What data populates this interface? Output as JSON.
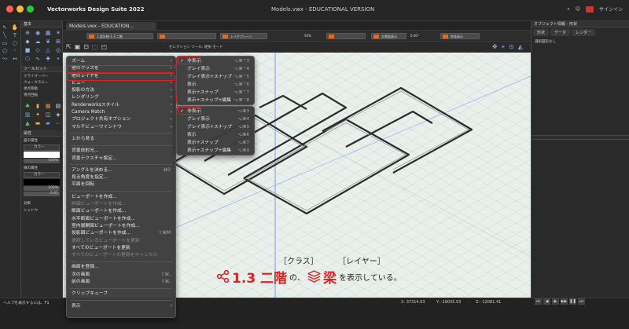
{
  "window": {
    "app_title": "Vectorworks Design Suite 2022",
    "document_title": "Models.vwx - EDUCATIONAL VERSION",
    "signin_label": "サインイン"
  },
  "colors": {
    "accent_red": "#e02020",
    "grid_bg": "#e9f0ec",
    "menu_bg": "#3c3c3c"
  },
  "left_panel": {
    "basic_title": "基本",
    "toolsets_title": "ツールセット",
    "toolsets": [
      "クライオーバー",
      "ウォークスルー",
      "視点移動",
      "視点回転"
    ],
    "attributes_title": "属性",
    "fill_label": "面の属性",
    "fill_value": "カラー",
    "line_label": "線の属性",
    "line_value": "カラー",
    "opacity_1": "100%",
    "opacity_2": "100%",
    "line_thickness": "0.05",
    "effects_label": "効果",
    "shadow_label": "シャドウ"
  },
  "tab_bar": {
    "doc_tab": "Models.vwx - EDUCATION..."
  },
  "toolbar": {
    "class_field": "1.設計物-1.3 二階",
    "layer_field": "レイヤプレーン",
    "scale_field": "0.00°",
    "zoom": "50%",
    "third_field": "左側面表示",
    "fourth_field": "吹抜表示",
    "mode_label": "セレクション ツール: 矩形 モード"
  },
  "context_menu": {
    "items": [
      {
        "label": "ズーム",
        "arrow": "›"
      },
      {
        "label": "他のクラスを",
        "arrow": "›"
      },
      {
        "label": "他のレイヤを",
        "arrow": "›"
      },
      {
        "label": "ビュー",
        "arrow": "›"
      },
      {
        "label": "投影の方法",
        "arrow": "›"
      },
      {
        "label": "レンダリング",
        "arrow": "›"
      },
      {
        "label": "Renderworksスタイル",
        "arrow": "›"
      },
      {
        "label": "Camera Match",
        "arrow": "›"
      },
      {
        "label": "プロジェクト共有オプション",
        "arrow": "›"
      },
      {
        "label": "マルチビューウインドウ",
        "arrow": "›"
      }
    ],
    "item_top_view": "上から見る",
    "items_bg": [
      "背景放射光...",
      "背景テクスチャ設定..."
    ],
    "items_angle": [
      {
        "label": "アングルを決める...",
        "sc": "⌘0"
      },
      {
        "label": "見る角度を指定...",
        "sc": ""
      },
      {
        "label": "平面を回転",
        "sc": ""
      }
    ],
    "items_viewport": [
      {
        "label": "ビューポートを作成...",
        "sc": "",
        "dis": false
      },
      {
        "label": "詳細ビューポートを作成...",
        "sc": "",
        "dis": true
      },
      {
        "label": "断面ビューポートを作成...",
        "sc": "",
        "dis": false
      },
      {
        "label": "水平断面ビューポートを作成...",
        "sc": "",
        "dis": false
      },
      {
        "label": "室内展開図ビューポートを作成...",
        "sc": "",
        "dis": false
      },
      {
        "label": "投影図ビューポートを作成...",
        "sc": "⇧⌘M",
        "dis": false
      },
      {
        "label": "選択しているビューポートを更新",
        "sc": "",
        "dis": true
      },
      {
        "label": "すべてのビューポートを更新",
        "sc": "",
        "dis": false
      },
      {
        "label": "すべてのビューポートの更新をキャンセル",
        "sc": "",
        "dis": true
      }
    ],
    "items_screen": [
      {
        "label": "画面を登録...",
        "sc": ""
      },
      {
        "label": "次の画面",
        "sc": "⇧⌘."
      },
      {
        "label": "前の画面",
        "sc": "⇧⌘,"
      }
    ],
    "item_clip": "クリップキューブ",
    "item_display": "表示"
  },
  "submenu_class": {
    "items": [
      {
        "label": "非表示",
        "sc": "⌥⌘⌃3",
        "check": "✓"
      },
      {
        "label": "グレイ表示",
        "sc": "⌥⌘⌃4",
        "check": ""
      },
      {
        "label": "グレイ表示+スナップ",
        "sc": "⌥⌘⌃5",
        "check": ""
      },
      {
        "label": "表示",
        "sc": "⌥⌘⌃6",
        "check": ""
      },
      {
        "label": "表示+スナップ",
        "sc": "⌥⌘⌃7",
        "check": ""
      },
      {
        "label": "表示+スナップ+編集",
        "sc": "⌥⌘⌃8",
        "check": ""
      }
    ]
  },
  "submenu_layer": {
    "items": [
      {
        "label": "非表示",
        "sc": "⌥⌘3",
        "check": "✓"
      },
      {
        "label": "グレイ表示",
        "sc": "⌥⌘4",
        "check": ""
      },
      {
        "label": "グレイ表示+スナップ",
        "sc": "⌥⌘5",
        "check": ""
      },
      {
        "label": "表示",
        "sc": "⌥⌘6",
        "check": ""
      },
      {
        "label": "表示+スナップ",
        "sc": "⌥⌘7",
        "check": ""
      },
      {
        "label": "表示+スナップ+編集",
        "sc": "⌥⌘9",
        "check": ""
      }
    ]
  },
  "annotation": {
    "class_label": "［クラス］",
    "layer_label": "［レイヤー］",
    "class_value": "1.3 二階",
    "particle_no": "の、",
    "layer_value": "梁",
    "suffix": "を表示している。"
  },
  "right_panel": {
    "title": "オブジェクト情報 - 形状",
    "tabs": [
      "形状",
      "データ",
      "レンダー"
    ],
    "no_selection": "選択図形なし"
  },
  "status": {
    "help": "ヘルプを表示するには、F1",
    "x": "X: 37314.63",
    "y": "Y: -19035.93",
    "z": "Z: -12081.41"
  }
}
